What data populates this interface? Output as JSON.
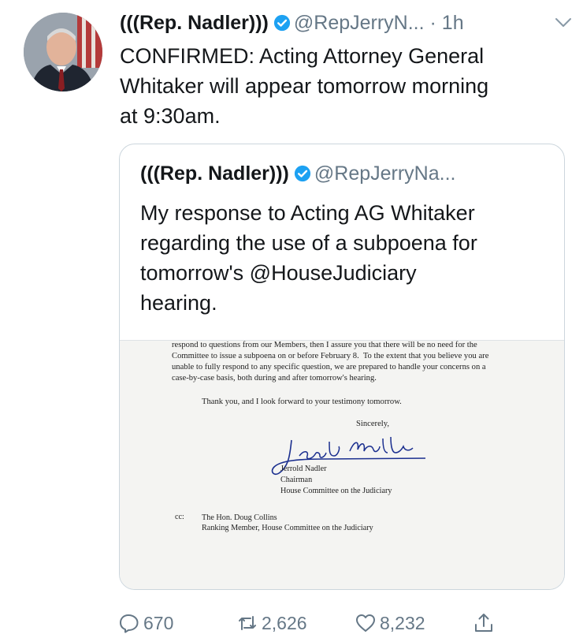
{
  "tweet": {
    "display_name": "(((Rep. Nadler)))",
    "handle": "@RepJerryN...",
    "time": "· 1h",
    "text": "CONFIRMED: Acting Attorney General\nWhitaker will appear tomorrow morning\nat 9:30am."
  },
  "quoted_tweet": {
    "display_name": "(((Rep. Nadler)))",
    "handle": "@RepJerryNa...",
    "text": "My response to Acting AG Whitaker\nregarding the use of a subpoena for\ntomorrow's @HouseJudiciary\nhearing.",
    "document": {
      "body": "respond to questions from our Members, then I assure you that there will be no need for the\nCommittee to issue a subpoena on or before February 8.  To the extent that you believe you are\nunable to fully respond to any specific question, we are prepared to handle your concerns on a\ncase-by-case basis, both during and after tomorrow's hearing.",
      "thanks": "Thank you, and I look forward to your testimony tomorrow.",
      "closing": "Sincerely,",
      "signature": "Jerrold Nadler",
      "signer_name": "Jerrold Nadler",
      "signer_title": "Chairman",
      "signer_committee": "House Committee on the Judiciary",
      "cc_label": "cc:",
      "cc_name": "The Hon. Doug Collins",
      "cc_title": "Ranking Member, House Committee on the Judiciary"
    }
  },
  "actions": {
    "replies": "670",
    "retweets": "2,626",
    "likes": "8,232"
  },
  "colors": {
    "verified": "#1da1f2",
    "secondary_text": "#657786",
    "border": "#ccd6dd"
  },
  "icons": [
    "verified-badge-icon",
    "chevron-down-icon",
    "reply-icon",
    "retweet-icon",
    "like-icon",
    "share-icon"
  ]
}
